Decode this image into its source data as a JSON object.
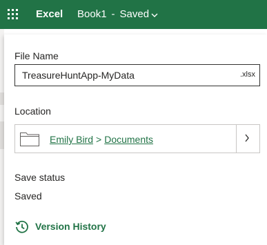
{
  "topbar": {
    "app_name": "Excel",
    "doc_name": "Book1",
    "separator": "-",
    "save_state": "Saved",
    "bg_color": "#217346"
  },
  "panel": {
    "file_name_label": "File Name",
    "file_name_value": "TreasureHuntApp-MyData",
    "file_extension": ".xlsx",
    "location_label": "Location",
    "location_path": [
      "Emily Bird",
      "Documents"
    ],
    "path_separator": ">",
    "save_status_label": "Save status",
    "save_status_value": "Saved",
    "version_history_label": "Version History"
  },
  "icons": {
    "app_launcher": "waffle-icon",
    "title_menu": "chevron-down-icon",
    "folder": "folder-icon",
    "location_browse": "chevron-right-icon",
    "version_history": "history-icon"
  },
  "colors": {
    "accent": "#217346",
    "text": "#252423",
    "border": "#c8c6c4"
  }
}
